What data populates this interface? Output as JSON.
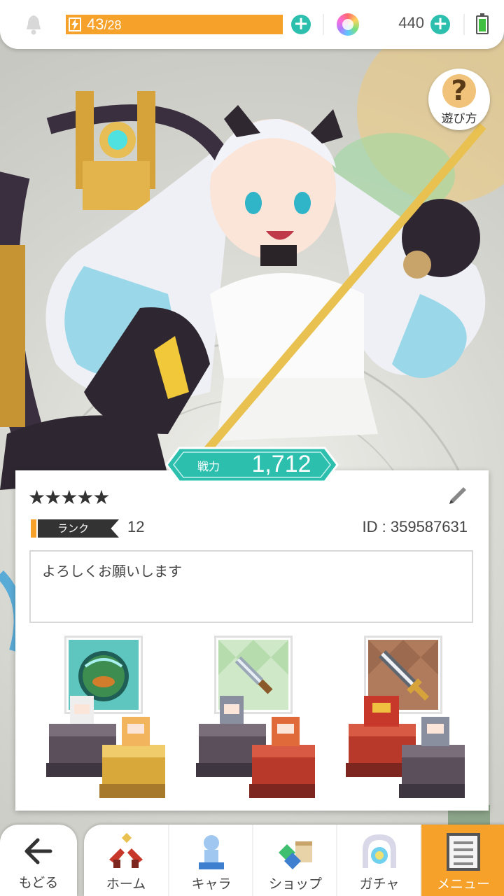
{
  "status_bar": {
    "stamina_current": "43",
    "stamina_max": "28",
    "gem_count": "440"
  },
  "help": {
    "label": "遊び方"
  },
  "power": {
    "label": "戦力",
    "value": "1,712"
  },
  "profile": {
    "stars": "★★★★★",
    "rank_label": "ランク",
    "rank_value": "12",
    "id_text": "ID : 359587631",
    "comment": "よろしくお願いします"
  },
  "teams": [
    {
      "weapon_icon": "orb-weapon-icon"
    },
    {
      "weapon_icon": "dagger-weapon-icon"
    },
    {
      "weapon_icon": "sword-weapon-icon"
    }
  ],
  "nav": {
    "back_label": "もどる",
    "items": [
      {
        "label": "ホーム",
        "icon": "home-icon"
      },
      {
        "label": "キャラ",
        "icon": "character-icon"
      },
      {
        "label": "ショップ",
        "icon": "shop-icon"
      },
      {
        "label": "ガチャ",
        "icon": "gacha-icon"
      },
      {
        "label": "メニュー",
        "icon": "menu-icon"
      }
    ],
    "active_color": "#f5a12a"
  },
  "colors": {
    "accent_teal": "#2dbfae",
    "stamina_orange": "#f5a12a"
  }
}
